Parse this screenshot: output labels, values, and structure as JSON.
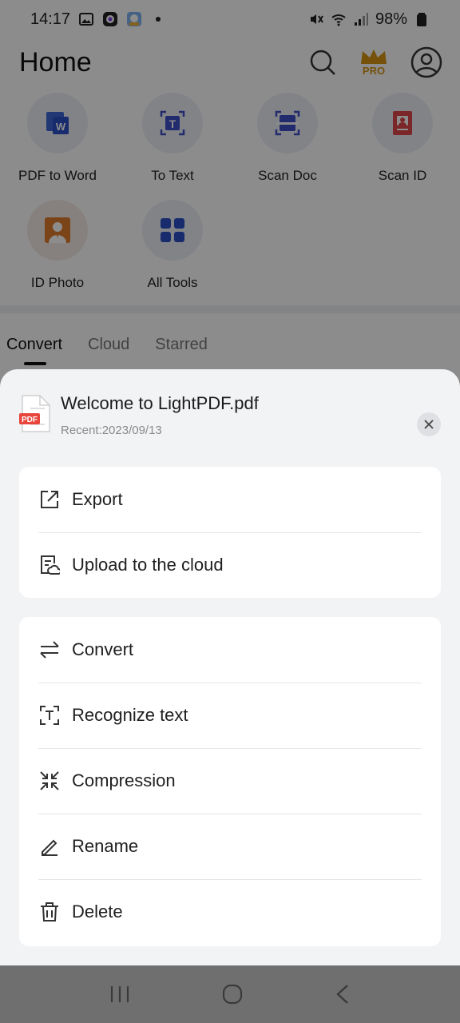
{
  "status_bar": {
    "time": "14:17",
    "battery": "98%"
  },
  "header": {
    "title": "Home",
    "pro_label": "PRO"
  },
  "tools": [
    {
      "label": "PDF to Word",
      "icon": "pdf-to-word-icon"
    },
    {
      "label": "To Text",
      "icon": "to-text-icon"
    },
    {
      "label": "Scan Doc",
      "icon": "scan-doc-icon"
    },
    {
      "label": "Scan ID",
      "icon": "scan-id-icon"
    },
    {
      "label": "ID Photo",
      "icon": "id-photo-icon"
    },
    {
      "label": "All Tools",
      "icon": "all-tools-icon"
    }
  ],
  "tabs": [
    {
      "label": "Convert",
      "active": true
    },
    {
      "label": "Cloud",
      "active": false
    },
    {
      "label": "Starred",
      "active": false
    }
  ],
  "sheet": {
    "file_name": "Welcome to LightPDF.pdf",
    "file_date": "Recent:2023/09/13",
    "pdf_badge": "PDF",
    "group1": [
      {
        "label": "Export",
        "icon": "export-icon"
      },
      {
        "label": "Upload to the cloud",
        "icon": "cloud-upload-icon"
      }
    ],
    "group2": [
      {
        "label": "Convert",
        "icon": "convert-icon"
      },
      {
        "label": "Recognize text",
        "icon": "recognize-text-icon"
      },
      {
        "label": "Compression",
        "icon": "compression-icon"
      },
      {
        "label": "Rename",
        "icon": "rename-icon"
      },
      {
        "label": "Delete",
        "icon": "trash-icon"
      }
    ]
  },
  "colors": {
    "accent": "#2b4fc6",
    "pdf_red": "#e8453c",
    "pro_gold": "#d59413"
  }
}
